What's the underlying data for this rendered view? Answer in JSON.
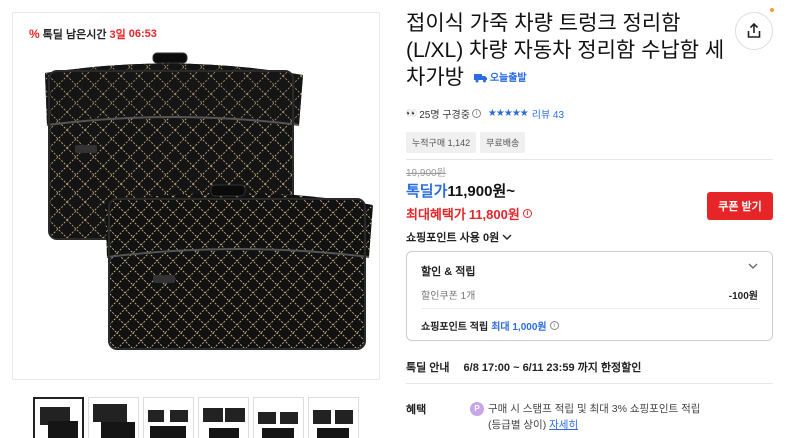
{
  "product": {
    "title": "접이식 가죽 차량 트렁크 정리함 (L/XL) 차량 자동차 정리함 수납함 세차가방",
    "delivery_badge": "오늘출발"
  },
  "timer": {
    "label": "톡딜 남은시간",
    "days": "3일",
    "time": "06:53"
  },
  "meta": {
    "viewers": "25명 구경중",
    "review_link": "리뷰 43",
    "rating_stars": 5
  },
  "tags": [
    "누적구매 1,142",
    "무료배송"
  ],
  "price": {
    "original": "19,900원",
    "deal_label": "톡딜가",
    "deal_value": "11,900원~",
    "max_label": "최대혜택가",
    "max_value": "11,800원"
  },
  "coupon_button": "쿠폰 받기",
  "points_use": "쇼핑포인트 사용 0원",
  "benefit_box": {
    "title": "할인 & 적립",
    "coupon_label": "할인쿠폰 1개",
    "coupon_value": "-100원",
    "points_label": "쇼핑포인트 적립",
    "points_value": "최대 1,000원"
  },
  "deal_notice": {
    "label": "톡딜 안내",
    "period": "6/8 17:00 ~ 6/11 23:59 까지 한정할인"
  },
  "benefit": {
    "label": "혜택",
    "icon_letter": "P",
    "text_line1": "구매 시 스탬프 적립 및 최대 3% 쇼핑포인트 적립",
    "text_line2": "(등급별 상이)",
    "link": "자세히"
  },
  "colors": {
    "accent_red": "#e52528",
    "accent_blue": "#2b6de0"
  }
}
